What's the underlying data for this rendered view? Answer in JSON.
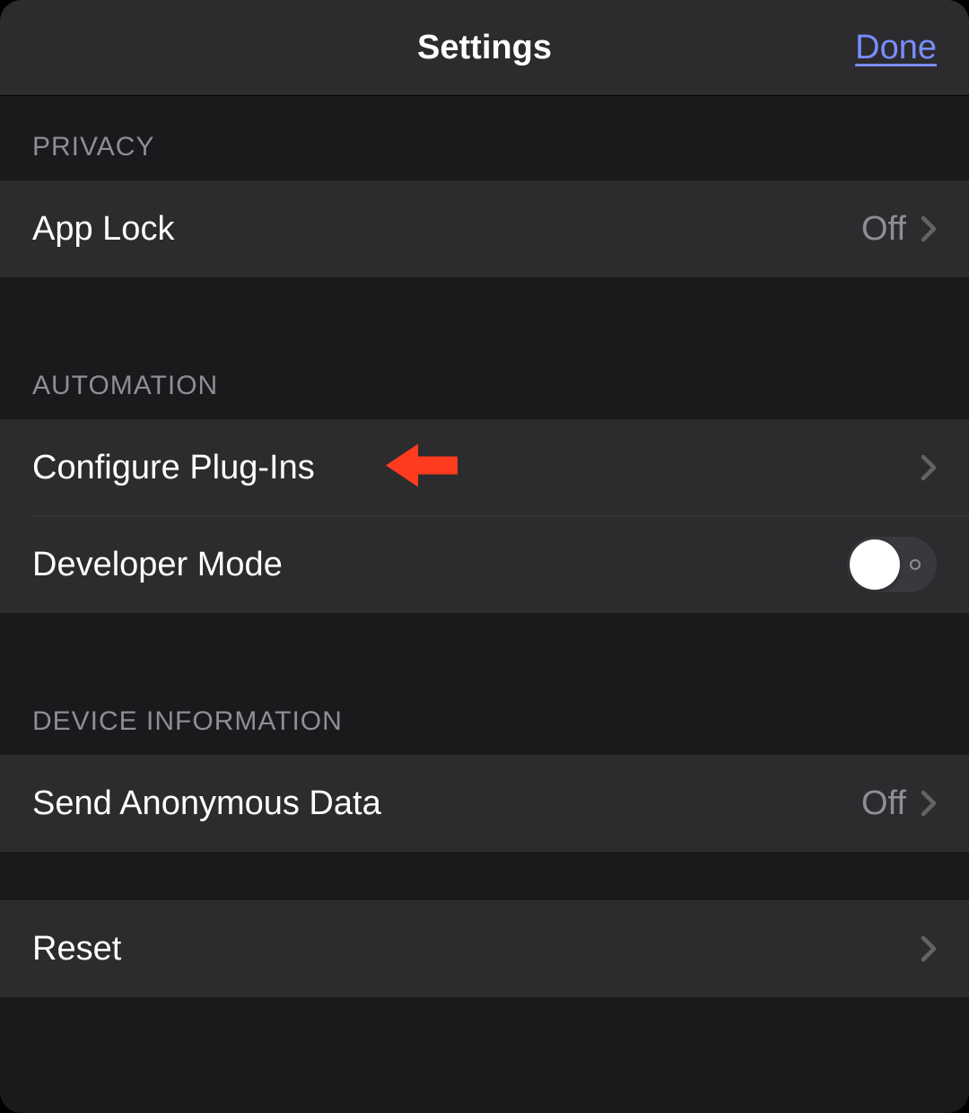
{
  "header": {
    "title": "Settings",
    "done": "Done"
  },
  "sections": {
    "privacy": {
      "header": "PRIVACY",
      "appLock": {
        "label": "App Lock",
        "value": "Off"
      }
    },
    "automation": {
      "header": "AUTOMATION",
      "configurePlugins": {
        "label": "Configure Plug-Ins"
      },
      "developerMode": {
        "label": "Developer Mode",
        "enabled": false
      }
    },
    "deviceInformation": {
      "header": "DEVICE INFORMATION",
      "sendAnonymousData": {
        "label": "Send Anonymous Data",
        "value": "Off"
      }
    },
    "reset": {
      "label": "Reset"
    }
  },
  "annotation": {
    "arrowColor": "#ff3b1f"
  }
}
